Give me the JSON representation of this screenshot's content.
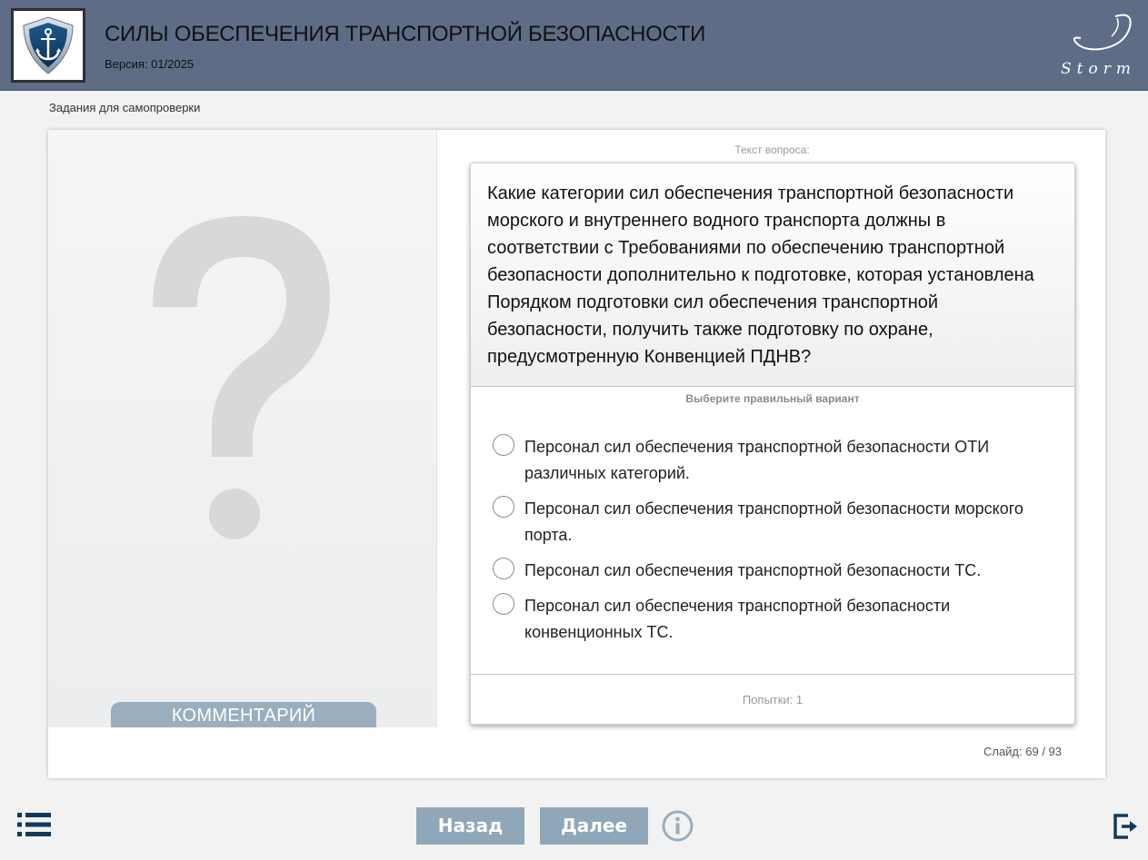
{
  "header": {
    "title": "СИЛЫ ОБЕСПЕЧЕНИЯ ТРАНСПОРТНОЙ БЕЗОПАСНОСТИ",
    "version": "Версия: 01/2025",
    "brand": "Storm"
  },
  "section_label": "Задания для самопроверки",
  "left_panel": {
    "comment_tab": "КОММЕНТАРИЙ"
  },
  "question": {
    "label": "Текст вопроса:",
    "text": "Какие категории сил обеспечения транспортной безопасности морского и внутреннего водного транспорта должны в соответствии с Требованиями по обеспечению транспортной безопасности дополнительно к подготовке, которая установлена Порядком подготовки сил обеспечения транспортной безопасности, получить также подготовку по охране, предусмотренную Конвенцией ПДНВ?",
    "hint": "Выберите правильный вариант",
    "options": [
      "Персонал сил обеспечения транспортной безопасности ОТИ различных категорий.",
      "Персонал сил обеспечения транспортной безопасности морского порта.",
      "Персонал сил обеспечения транспортной безопасности ТС.",
      "Персонал сил обеспечения транспортной безопасности конвенционных ТС."
    ],
    "attempts": "Попытки: 1"
  },
  "slide_counter": "Слайд:  69 / 93",
  "nav": {
    "back": "Назад",
    "next": "Далее"
  },
  "icons": {
    "menu": "list-icon",
    "info": "info-icon",
    "exit": "exit-icon",
    "logo": "anchor-shield-logo"
  },
  "colors": {
    "header_bg": "#5e6c86",
    "button_bg": "#8fa7b8",
    "comment_tab_bg": "#9aafbd",
    "icon_navy": "#123a5a"
  }
}
